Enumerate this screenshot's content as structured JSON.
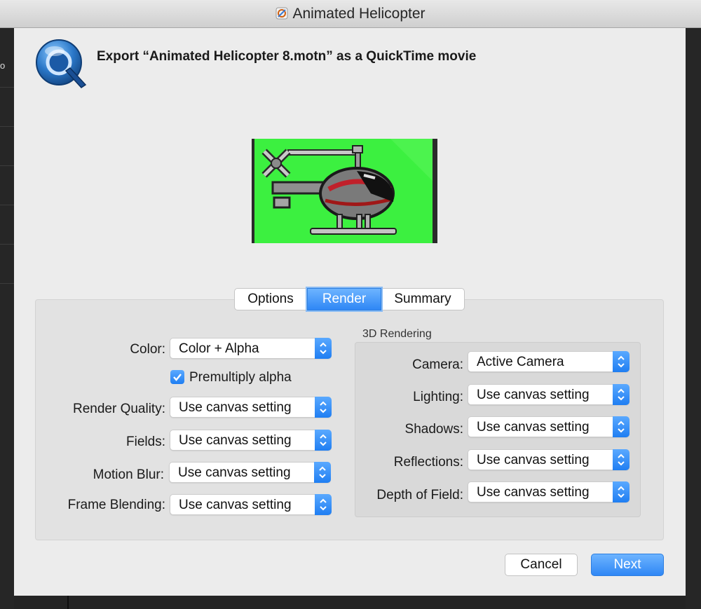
{
  "window": {
    "title": "Animated Helicopter"
  },
  "dialog": {
    "heading": "Export “Animated Helicopter 8.motn” as a QuickTime movie"
  },
  "tabs": [
    {
      "label": "Options",
      "selected": false
    },
    {
      "label": "Render",
      "selected": true
    },
    {
      "label": "Summary",
      "selected": false
    }
  ],
  "render": {
    "color": {
      "label": "Color:",
      "value": "Color + Alpha"
    },
    "premultiply": {
      "label": "Premultiply alpha",
      "checked": true
    },
    "render_quality": {
      "label": "Render Quality:",
      "value": "Use canvas setting"
    },
    "fields": {
      "label": "Fields:",
      "value": "Use canvas setting"
    },
    "motion_blur": {
      "label": "Motion Blur:",
      "value": "Use canvas setting"
    },
    "frame_blending": {
      "label": "Frame Blending:",
      "value": "Use canvas setting"
    }
  },
  "rendering3d": {
    "title": "3D Rendering",
    "camera": {
      "label": "Camera:",
      "value": "Active Camera"
    },
    "lighting": {
      "label": "Lighting:",
      "value": "Use canvas setting"
    },
    "shadows": {
      "label": "Shadows:",
      "value": "Use canvas setting"
    },
    "reflections": {
      "label": "Reflections:",
      "value": "Use canvas setting"
    },
    "depth_of_field": {
      "label": "Depth of Field:",
      "value": "Use canvas setting"
    }
  },
  "buttons": {
    "cancel": "Cancel",
    "next": "Next"
  },
  "background": {
    "side_glyph": "o"
  },
  "colors": {
    "accent": "#2f87f5",
    "preview_green": "#3cf040",
    "sheet_bg": "#ececec"
  },
  "icons": {
    "app": "motion-app-icon",
    "quicktime": "quicktime-logo-icon",
    "popup": "chevron-updown-icon",
    "checkbox": "checkmark-icon"
  }
}
